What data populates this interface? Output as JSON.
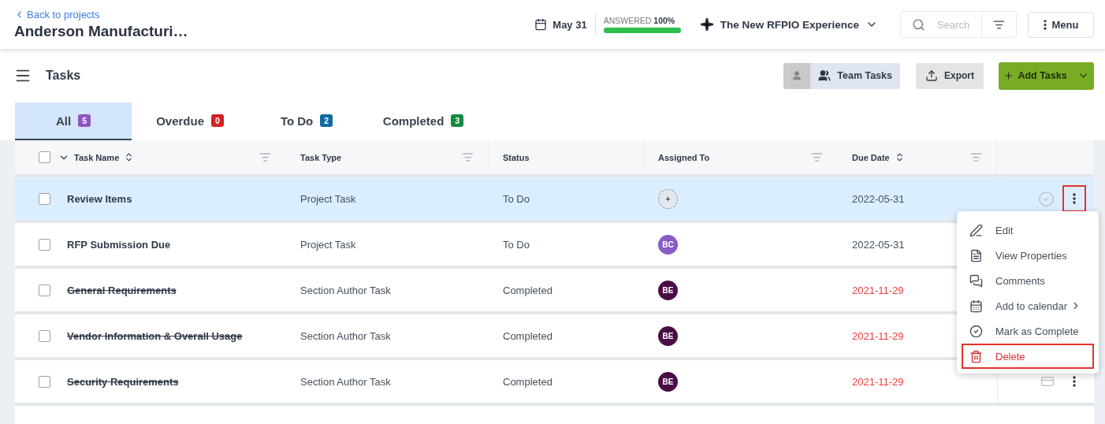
{
  "header": {
    "back_link": "Back to projects",
    "project_title": "Anderson Manufacturi…",
    "due_date": "May 31",
    "answered": {
      "label": "ANSWERED",
      "value": "100%",
      "level": 1
    },
    "experience": "The New RFPIO Experience",
    "search": {
      "placeholder": "Search"
    },
    "menu_button": "Menu"
  },
  "toolbar": {
    "title": "Tasks",
    "view_toggle": {
      "personal_selected": false,
      "team_selected": true,
      "team_label": "Team Tasks"
    },
    "export_button": "Export",
    "add_button": "Add Tasks"
  },
  "tabs": [
    {
      "label": "All",
      "count": "5",
      "color": "#8e57c2",
      "selected": true
    },
    {
      "label": "Overdue",
      "count": "0",
      "color": "#d32222",
      "selected": false
    },
    {
      "label": "To Do",
      "count": "2",
      "color": "#0f6aa0",
      "selected": false
    },
    {
      "label": "Completed",
      "count": "3",
      "color": "#168a3f",
      "selected": false
    }
  ],
  "table": {
    "select_all_checked": false,
    "columns": [
      {
        "label": "Task Name",
        "sortable": true,
        "filterable": true
      },
      {
        "label": "Task Type",
        "sortable": false,
        "filterable": true
      },
      {
        "label": "Status",
        "sortable": false,
        "filterable": false
      },
      {
        "label": "Assigned To",
        "sortable": false,
        "filterable": true
      },
      {
        "label": "Due Date",
        "sortable": true,
        "filterable": true
      }
    ],
    "rows": [
      {
        "kind": "open",
        "name": "Review Items",
        "type": "Project Task",
        "status": "To Do",
        "assignee": {
          "kind": "add",
          "initials": "+",
          "color": "#e3e8ef"
        },
        "due": "2022-05-31",
        "completed": false,
        "overdue": false,
        "selected": true,
        "checked": false
      },
      {
        "kind": "covered",
        "name": "RFP Submission Due",
        "type": "Project Task",
        "status": "To Do",
        "assignee": {
          "kind": "person",
          "initials": "BC",
          "color": "#8a5cc7"
        },
        "due": "2022-05-31",
        "completed": false,
        "overdue": false,
        "selected": false,
        "checked": false
      },
      {
        "kind": "covered",
        "name": "General Requirements",
        "type": "Section Author Task",
        "status": "Completed",
        "assignee": {
          "kind": "person",
          "initials": "BE",
          "color": "#4a0d45"
        },
        "due": "2021-11-29",
        "completed": true,
        "overdue": true,
        "selected": false,
        "checked": false
      },
      {
        "kind": "covered",
        "name": "Vendor Information & Overall Usage",
        "type": "Section Author Task",
        "status": "Completed",
        "assignee": {
          "kind": "person",
          "initials": "BE",
          "color": "#4a0d45"
        },
        "due": "2021-11-29",
        "completed": true,
        "overdue": true,
        "selected": false,
        "checked": false
      },
      {
        "kind": "archived",
        "name": "Security Requirements",
        "type": "Section Author Task",
        "status": "Completed",
        "assignee": {
          "kind": "person",
          "initials": "BE",
          "color": "#4a0d45"
        },
        "due": "2021-11-29",
        "completed": true,
        "overdue": true,
        "selected": false,
        "checked": false
      }
    ]
  },
  "context_menu": [
    {
      "kind": "edit",
      "label": "Edit",
      "highlighted": false
    },
    {
      "kind": "properties",
      "label": "View Properties",
      "highlighted": false
    },
    {
      "kind": "comments",
      "label": "Comments",
      "highlighted": false
    },
    {
      "kind": "calendar",
      "label": "Add to calendar",
      "highlighted": false
    },
    {
      "kind": "complete",
      "label": "Mark as Complete",
      "highlighted": false
    },
    {
      "kind": "delete",
      "label": "Delete",
      "highlighted": true
    }
  ]
}
